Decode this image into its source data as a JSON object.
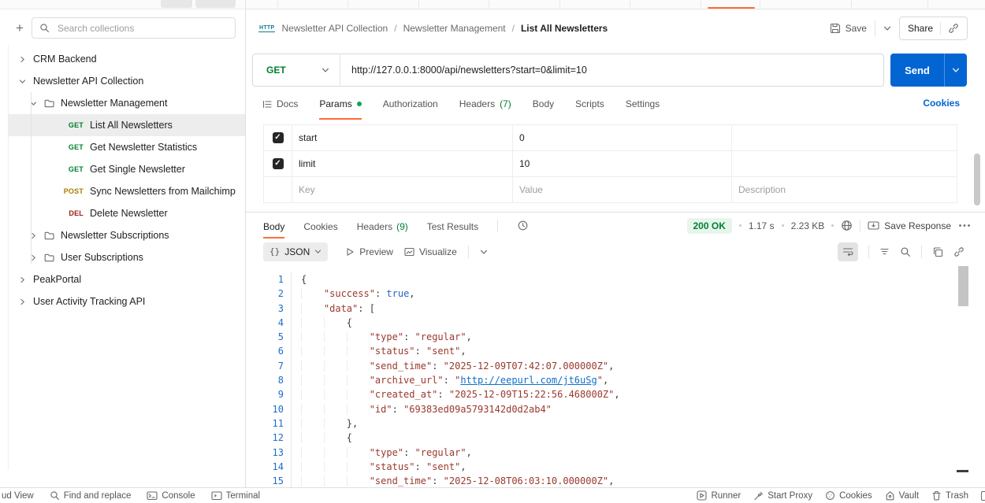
{
  "sidebar": {
    "add_label": "+",
    "search_placeholder": "Search collections",
    "items": [
      {
        "label": "CRM Backend",
        "type": "collection",
        "chevron": "right",
        "level": 0
      },
      {
        "label": "Newsletter API Collection",
        "type": "collection",
        "chevron": "down",
        "level": 0
      },
      {
        "label": "Newsletter Management",
        "type": "folder",
        "chevron": "down",
        "level": 1
      },
      {
        "label": "List All Newsletters",
        "type": "request",
        "method": "GET",
        "level": 2,
        "selected": true
      },
      {
        "label": "Get Newsletter Statistics",
        "type": "request",
        "method": "GET",
        "level": 2
      },
      {
        "label": "Get Single Newsletter",
        "type": "request",
        "method": "GET",
        "level": 2
      },
      {
        "label": "Sync Newsletters from Mailchimp",
        "type": "request",
        "method": "POST",
        "level": 2
      },
      {
        "label": "Delete Newsletter",
        "type": "request",
        "method": "DEL",
        "level": 2
      },
      {
        "label": "Newsletter Subscriptions",
        "type": "folder",
        "chevron": "right",
        "level": 1
      },
      {
        "label": "User Subscriptions",
        "type": "folder",
        "chevron": "right",
        "level": 1
      },
      {
        "label": "PeakPortal",
        "type": "collection",
        "chevron": "right",
        "level": 0
      },
      {
        "label": "User Activity Tracking API",
        "type": "collection",
        "chevron": "right",
        "level": 0
      }
    ]
  },
  "breadcrumb": {
    "crumbs": [
      "Newsletter API Collection",
      "Newsletter Management",
      "List All Newsletters"
    ]
  },
  "actions": {
    "save": "Save",
    "share": "Share"
  },
  "request": {
    "method": "GET",
    "url": "http://127.0.0.1:8000/api/newsletters?start=0&limit=10",
    "send": "Send"
  },
  "request_tabs": {
    "tabs": [
      {
        "label": "Docs"
      },
      {
        "label": "Params"
      },
      {
        "label": "Authorization"
      },
      {
        "label": "Headers",
        "count": "(7)"
      },
      {
        "label": "Body"
      },
      {
        "label": "Scripts"
      },
      {
        "label": "Settings"
      }
    ],
    "cookies": "Cookies"
  },
  "params": {
    "rows": [
      {
        "key": "start",
        "value": "0",
        "description": ""
      },
      {
        "key": "limit",
        "value": "10",
        "description": ""
      }
    ],
    "placeholder": {
      "key": "Key",
      "value": "Value",
      "description": "Description"
    }
  },
  "response": {
    "tabs": [
      {
        "label": "Body"
      },
      {
        "label": "Cookies"
      },
      {
        "label": "Headers",
        "count": "(9)"
      },
      {
        "label": "Test Results"
      }
    ],
    "status": "200 OK",
    "time": "1.17 s",
    "size": "2.23 KB",
    "save_response": "Save Response",
    "toolbar": {
      "format": "JSON",
      "preview": "Preview",
      "visualize": "Visualize"
    },
    "code": {
      "lines": [
        [
          [
            "pt",
            "{"
          ]
        ],
        [
          [
            "w",
            "    "
          ],
          [
            "k",
            "\"success\""
          ],
          [
            "pt",
            ": "
          ],
          [
            "b",
            "true"
          ],
          [
            "pt",
            ","
          ]
        ],
        [
          [
            "w",
            "    "
          ],
          [
            "k",
            "\"data\""
          ],
          [
            "pt",
            ": ["
          ]
        ],
        [
          [
            "w",
            "        "
          ],
          [
            "pt",
            "{"
          ]
        ],
        [
          [
            "w",
            "            "
          ],
          [
            "k",
            "\"type\""
          ],
          [
            "pt",
            ": "
          ],
          [
            "s",
            "\"regular\""
          ],
          [
            "pt",
            ","
          ]
        ],
        [
          [
            "w",
            "            "
          ],
          [
            "k",
            "\"status\""
          ],
          [
            "pt",
            ": "
          ],
          [
            "s",
            "\"sent\""
          ],
          [
            "pt",
            ","
          ]
        ],
        [
          [
            "w",
            "            "
          ],
          [
            "k",
            "\"send_time\""
          ],
          [
            "pt",
            ": "
          ],
          [
            "s",
            "\"2025-12-09T07:42:07.000000Z\""
          ],
          [
            "pt",
            ","
          ]
        ],
        [
          [
            "w",
            "            "
          ],
          [
            "k",
            "\"archive_url\""
          ],
          [
            "pt",
            ": "
          ],
          [
            "s",
            "\""
          ],
          [
            "ln",
            "http://eepurl.com/jt6uSg"
          ],
          [
            "s",
            "\""
          ],
          [
            "pt",
            ","
          ]
        ],
        [
          [
            "w",
            "            "
          ],
          [
            "k",
            "\"created_at\""
          ],
          [
            "pt",
            ": "
          ],
          [
            "s",
            "\"2025-12-09T15:22:56.468000Z\""
          ],
          [
            "pt",
            ","
          ]
        ],
        [
          [
            "w",
            "            "
          ],
          [
            "k",
            "\"id\""
          ],
          [
            "pt",
            ": "
          ],
          [
            "s",
            "\"69383ed09a5793142d0d2ab4\""
          ]
        ],
        [
          [
            "w",
            "        "
          ],
          [
            "pt",
            "},"
          ]
        ],
        [
          [
            "w",
            "        "
          ],
          [
            "pt",
            "{"
          ]
        ],
        [
          [
            "w",
            "            "
          ],
          [
            "k",
            "\"type\""
          ],
          [
            "pt",
            ": "
          ],
          [
            "s",
            "\"regular\""
          ],
          [
            "pt",
            ","
          ]
        ],
        [
          [
            "w",
            "            "
          ],
          [
            "k",
            "\"status\""
          ],
          [
            "pt",
            ": "
          ],
          [
            "s",
            "\"sent\""
          ],
          [
            "pt",
            ","
          ]
        ],
        [
          [
            "w",
            "            "
          ],
          [
            "k",
            "\"send_time\""
          ],
          [
            "pt",
            ": "
          ],
          [
            "s",
            "\"2025-12-08T06:03:10.000000Z\""
          ],
          [
            "pt",
            ","
          ]
        ]
      ]
    }
  },
  "statusbar": {
    "left": [
      {
        "label": "ud View"
      },
      {
        "label": "Find and replace"
      },
      {
        "label": "Console"
      },
      {
        "label": "Terminal"
      }
    ],
    "right": [
      {
        "label": "Runner"
      },
      {
        "label": "Start Proxy"
      },
      {
        "label": "Cookies"
      },
      {
        "label": "Vault"
      },
      {
        "label": "Trash"
      }
    ]
  },
  "colors": {
    "accent_orange": "#ff6c37",
    "get_green": "#007f31",
    "post_amber": "#ad7a03",
    "delete_red": "#9e1c10",
    "send_blue": "#0265d2",
    "status_ok_green": "#007f31",
    "link_blue": "#0265d2"
  }
}
